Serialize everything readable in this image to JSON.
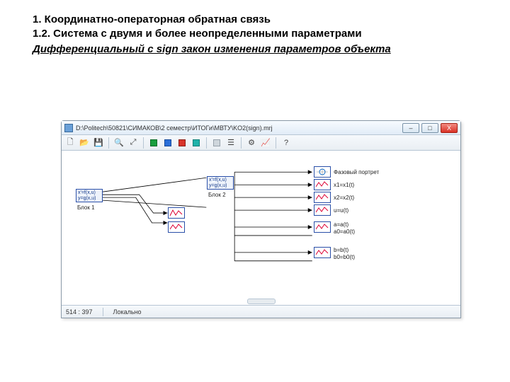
{
  "heading1": "1. Координатно-операторная обратная связь",
  "heading2": "1.2. Система с двумя и более неопределенными параметрами",
  "subtitle": "Дифференциальный с sign закон изменения параметров объекта",
  "window": {
    "title": "D:\\Politech\\50821\\СИМАКОВ\\2 семестр\\ИТОГи\\МВТУ\\KO2(sign).mrj",
    "btn_min": "–",
    "btn_max": "□",
    "btn_close": "X"
  },
  "toolbar": {
    "items": [
      "new",
      "open",
      "save",
      "sep",
      "find",
      "zoom",
      "sep",
      "run-green",
      "run-blue",
      "stop-red",
      "pause-teal",
      "sep",
      "grid",
      "layers",
      "sep",
      "settings",
      "plot",
      "sep",
      "help"
    ]
  },
  "canvas": {
    "block1": {
      "line1": "x'=f(x,u)",
      "line2": "y=g(x,u)",
      "label": "Блок 1"
    },
    "block2": {
      "line1": "x'=f(x,u)",
      "line2": "y=g(x,u)",
      "label": "Блок 2"
    },
    "phase_label": "Фазовый портрет",
    "signals": [
      {
        "label": "x1=x1(t)"
      },
      {
        "label": "x2=x2(t)"
      },
      {
        "label": "u=u(t)"
      },
      {
        "label": "a=a(t)"
      },
      {
        "label": "a0=a0(t)"
      },
      {
        "label": "b=b(t)"
      },
      {
        "label": "b0=b0(t)"
      }
    ]
  },
  "status": {
    "coords": "514 : 397",
    "mode": "Локально"
  }
}
